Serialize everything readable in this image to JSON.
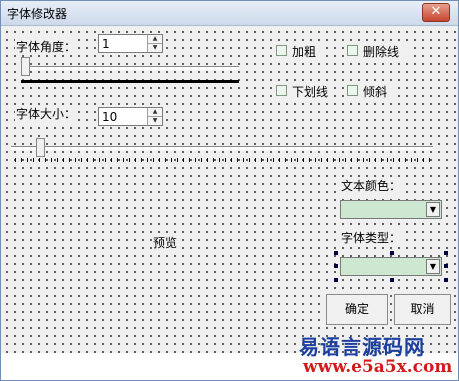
{
  "window": {
    "title": "字体修改器",
    "close_glyph": "✕"
  },
  "angle": {
    "label": "字体角度：",
    "value": "1",
    "slider_fraction": 0.0
  },
  "size": {
    "label": "字体大小：",
    "value": "10",
    "slider_fraction": 0.06
  },
  "checkboxes": [
    {
      "label": "加粗",
      "checked": false
    },
    {
      "label": "删除线",
      "checked": false
    },
    {
      "label": "下划线",
      "checked": false
    },
    {
      "label": "倾斜",
      "checked": false
    }
  ],
  "text_color": {
    "label": "文本颜色：",
    "value": ""
  },
  "font_type": {
    "label": "字体类型：",
    "value": ""
  },
  "preview": {
    "text": "预览"
  },
  "buttons": {
    "ok": "确定",
    "cancel": "取消"
  },
  "watermark": {
    "brand": "易语言源码网",
    "url": "www.e5a5x.com"
  },
  "colors": {
    "combo_fill": "#cde7d0",
    "brand": "#1d3fa0",
    "url": "#d21a1a"
  }
}
